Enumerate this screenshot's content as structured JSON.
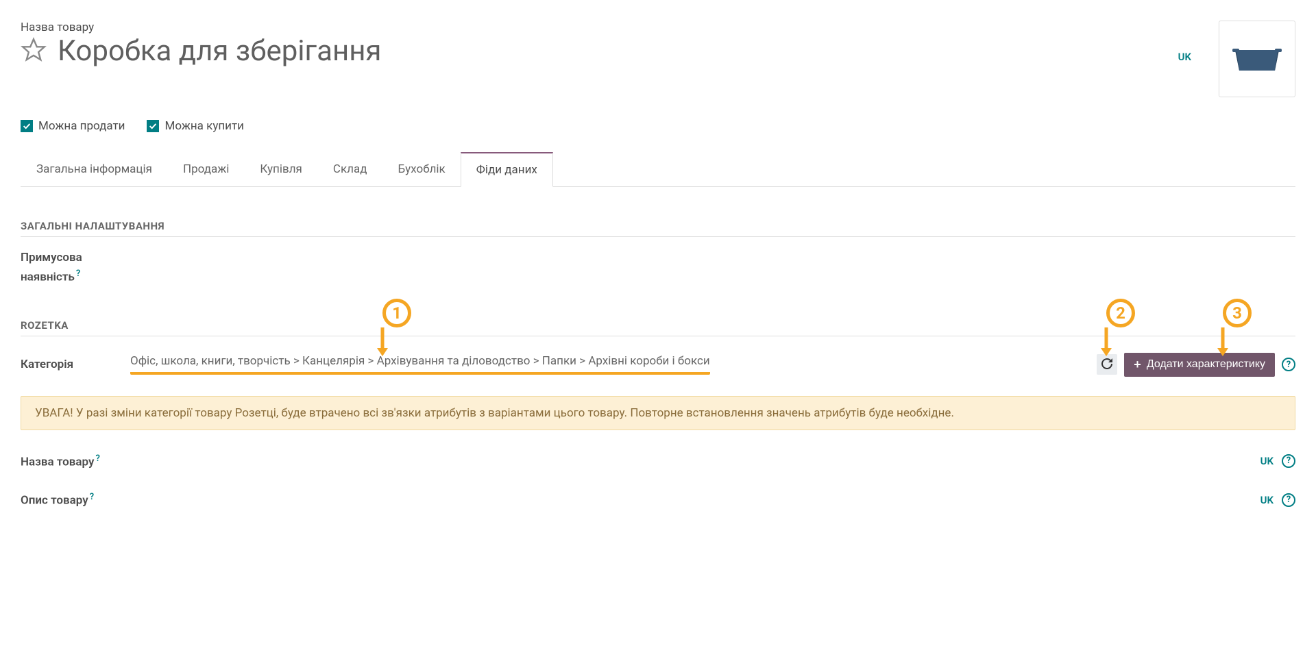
{
  "header": {
    "label": "Назва товару",
    "title": "Коробка для зберігання",
    "lang": "UK"
  },
  "checkboxes": {
    "can_sell": "Можна продати",
    "can_buy": "Можна купити"
  },
  "tabs": [
    "Загальна інформація",
    "Продажі",
    "Купівля",
    "Склад",
    "Бухоблік",
    "Фіди даних"
  ],
  "sections": {
    "general": "ЗАГАЛЬНІ НАЛАШТУВАННЯ",
    "rozetka": "ROZETKA"
  },
  "fields": {
    "forced_availability_l1": "Примусова",
    "forced_availability_l2": "наявність",
    "category_label": "Категорія",
    "category_value": "Офіс, школа, книги, творчість > Канцелярія > Архівування та діловодство > Папки > Архівні короби і бокси",
    "product_name": "Назва товару",
    "product_desc": "Опис товару"
  },
  "buttons": {
    "add_characteristic": "Додати характеристику"
  },
  "warning": "УВАГА! У разі зміни категорії товару Розетці, буде втрачено всі зв'язки атрибутів з варіантами цього товару. Повторне встановлення значень атрибутів буде необхідне.",
  "annotations": {
    "a1": "1",
    "a2": "2",
    "a3": "3"
  },
  "lang_inline": "UK"
}
